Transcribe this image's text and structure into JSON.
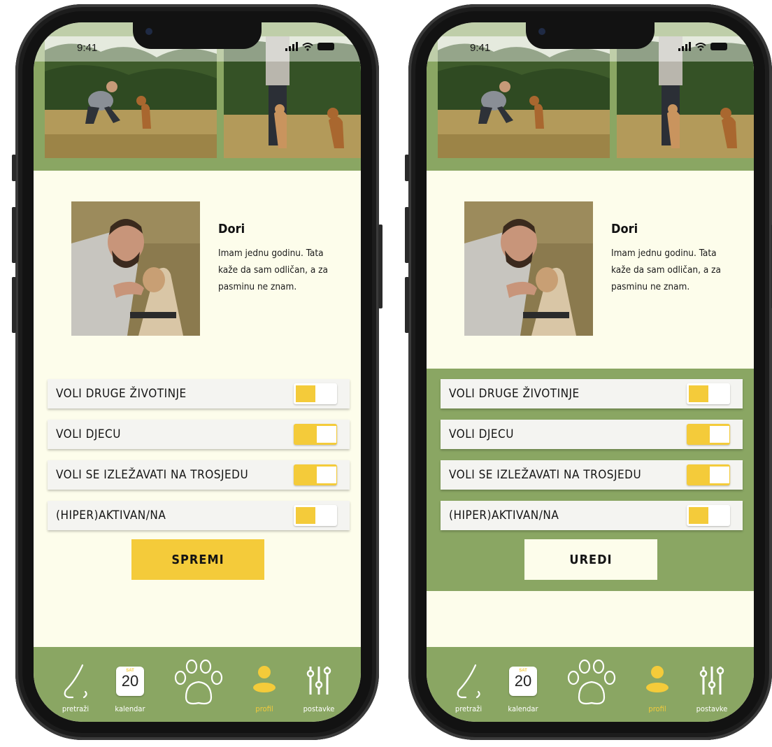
{
  "status_bar": {
    "time": "9:41"
  },
  "screens": [
    {
      "dog": {
        "name": "Dori",
        "bio": "Imam jednu godinu. Tata kaže da sam odličan, a za pasminu ne znam."
      },
      "traits": [
        {
          "label": "VOLI DRUGE ŽIVOTINJE",
          "on": false
        },
        {
          "label": "VOLI DJECU",
          "on": true
        },
        {
          "label": "VOLI SE IZLEŽAVATI NA TROSJEDU",
          "on": true
        },
        {
          "label": "(HIPER)AKTIVAN/NA",
          "on": false
        }
      ],
      "action_label": "SPREMI"
    },
    {
      "dog": {
        "name": "Dori",
        "bio": "Imam jednu godinu. Tata kaže da sam odličan, a za pasminu ne znam."
      },
      "traits": [
        {
          "label": "VOLI DRUGE ŽIVOTINJE",
          "on": false
        },
        {
          "label": "VOLI DJECU",
          "on": true
        },
        {
          "label": "VOLI SE IZLEŽAVATI NA TROSJEDU",
          "on": true
        },
        {
          "label": "(HIPER)AKTIVAN/NA",
          "on": false
        }
      ],
      "action_label": "UREDI"
    }
  ],
  "nav": {
    "search": "pretraži",
    "calendar": "kalendar",
    "calendar_day": "SAT",
    "calendar_date": "20",
    "profile": "profil",
    "settings": "postavke"
  },
  "colors": {
    "green": "#8aa663",
    "cream": "#fdfdeb",
    "yellow": "#f4cb3a"
  }
}
